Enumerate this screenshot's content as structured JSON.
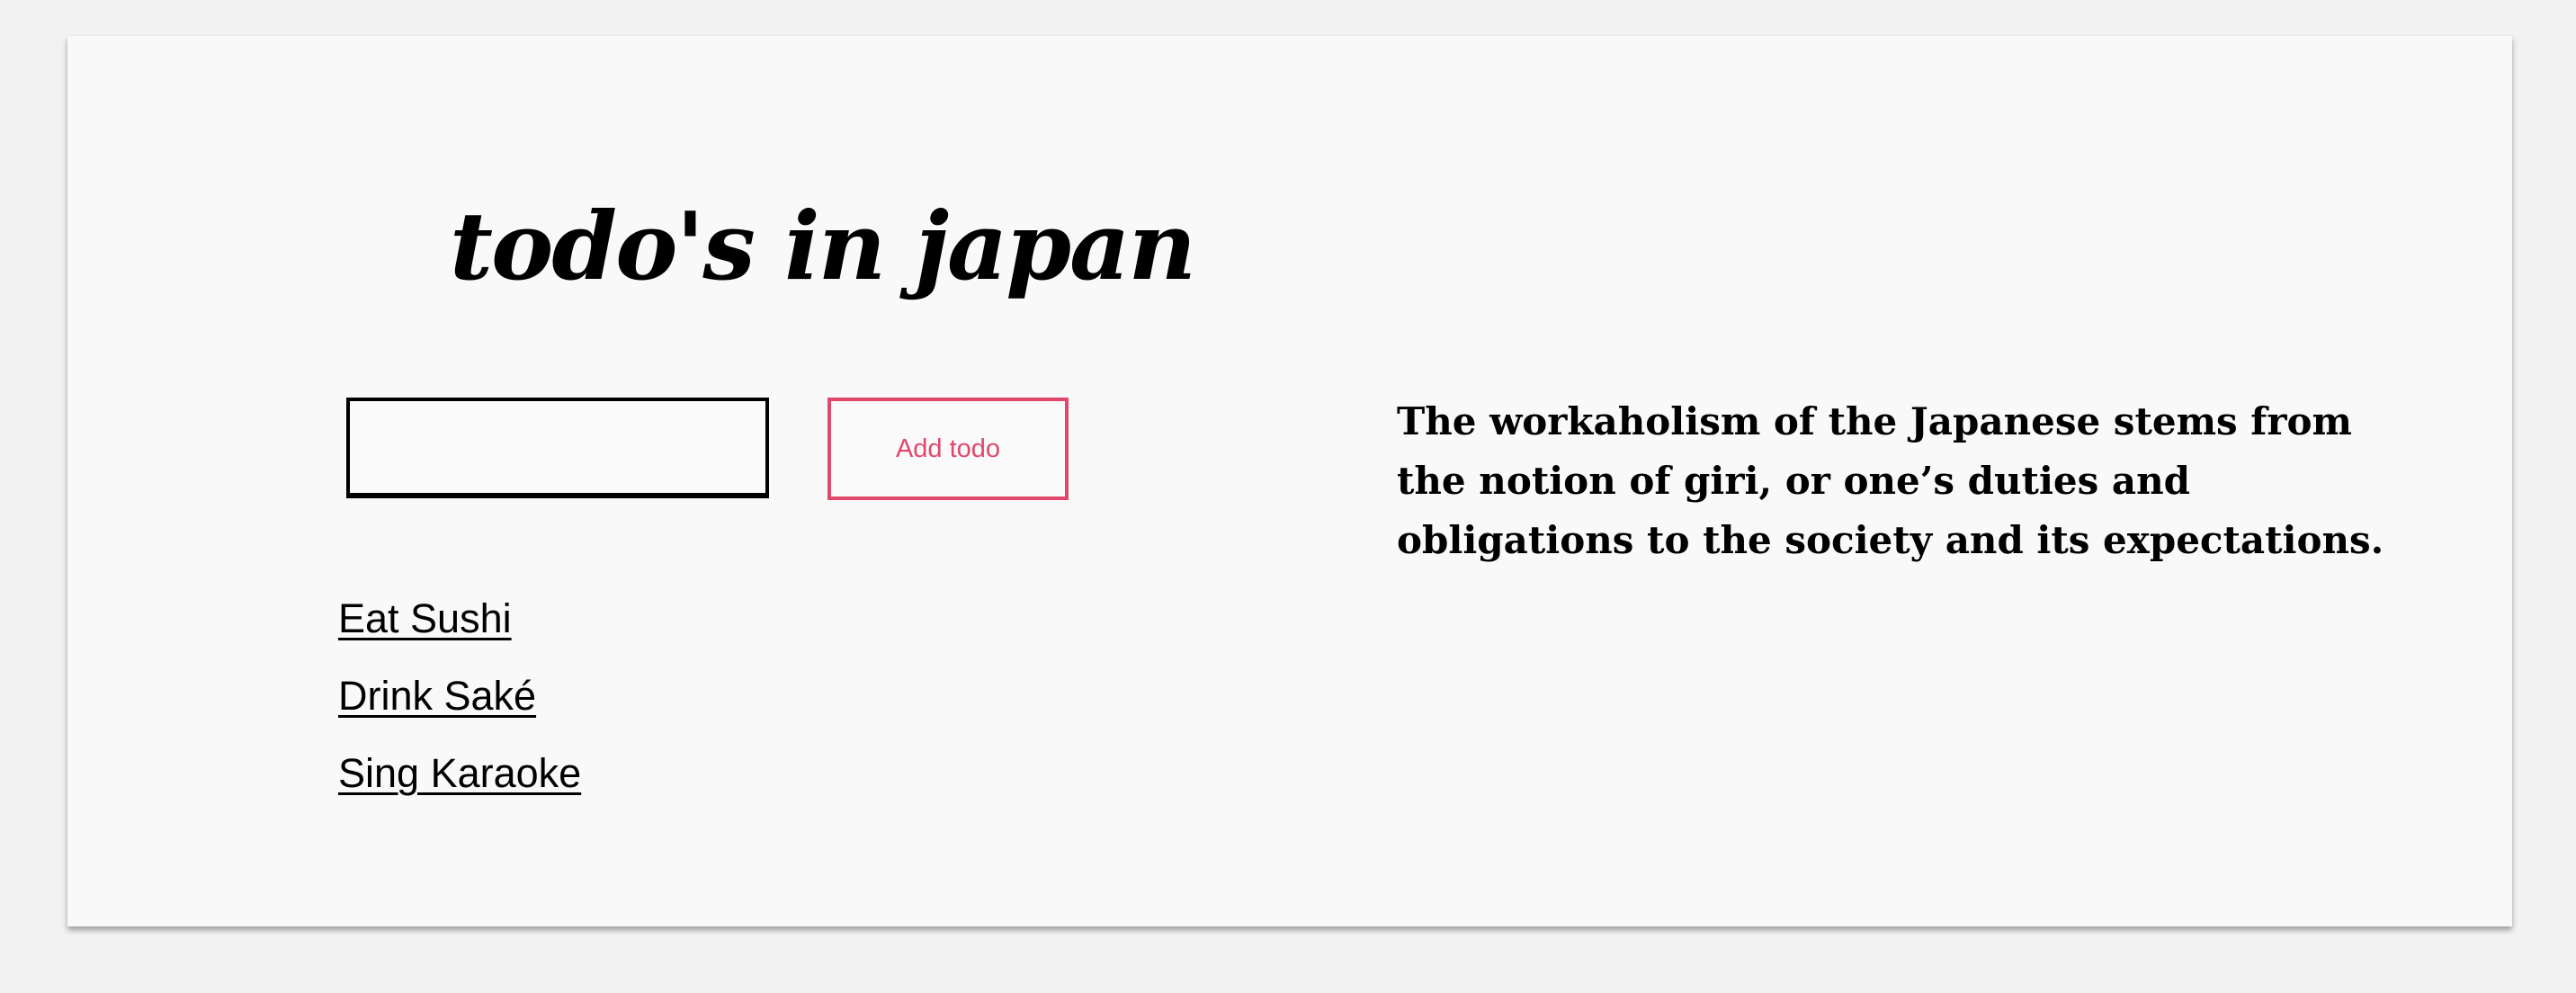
{
  "header": {
    "title": "todo's in japan"
  },
  "form": {
    "input_value": "",
    "input_placeholder": "",
    "add_button_label": "Add todo"
  },
  "todos": [
    {
      "label": "Eat Sushi"
    },
    {
      "label": "Drink Saké"
    },
    {
      "label": "Sing Karaoke"
    }
  ],
  "quote": {
    "text": "The workaholism of the Japanese stems from the notion of giri, or one’s duties and obligations to the society and its expectations."
  },
  "colors": {
    "accent": "#e0486b",
    "page_background": "#f2f2f2",
    "card_background": "#f9f9f9",
    "text": "#000000"
  }
}
